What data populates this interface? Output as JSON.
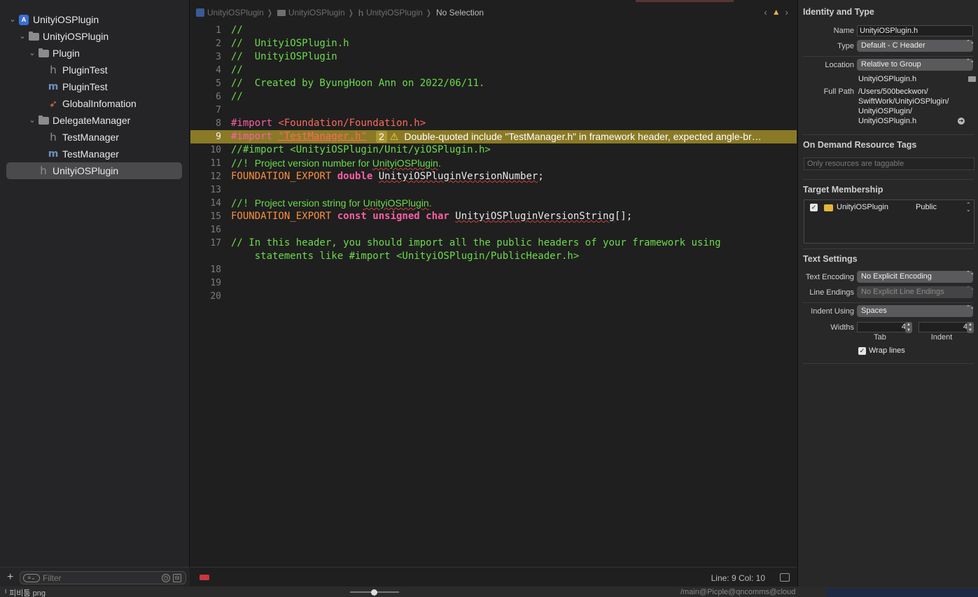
{
  "navigator": {
    "tree": [
      {
        "label": "UnityiOSPlugin",
        "icon": "project-icon",
        "level": 0,
        "expanded": true
      },
      {
        "label": "UnityiOSPlugin",
        "icon": "folder-icon",
        "level": 1,
        "expanded": true
      },
      {
        "label": "Plugin",
        "icon": "folder-icon",
        "level": 2,
        "expanded": true
      },
      {
        "label": "PluginTest",
        "icon": "header-file-icon",
        "level": 3
      },
      {
        "label": "PluginTest",
        "icon": "objc-file-icon",
        "level": 3
      },
      {
        "label": "GlobalInfomation",
        "icon": "swift-file-icon",
        "level": 3
      },
      {
        "label": "DelegateManager",
        "icon": "folder-icon",
        "level": 2,
        "expanded": true
      },
      {
        "label": "TestManager",
        "icon": "header-file-icon",
        "level": 3
      },
      {
        "label": "TestManager",
        "icon": "objc-file-icon",
        "level": 3
      },
      {
        "label": "UnityiOSPlugin",
        "icon": "header-file-icon",
        "level": 2,
        "selected": true
      }
    ],
    "filter_placeholder": "Filter"
  },
  "jumpbar": {
    "items": [
      "UnityiOSPlugin",
      "UnityiOSPlugin",
      "UnityiOSPlugin"
    ],
    "selection": "No Selection"
  },
  "editor": {
    "lines": {
      "l1": {
        "num": "1",
        "text": "//"
      },
      "l2": {
        "num": "2",
        "text": "//  UnityiOSPlugin.h"
      },
      "l3": {
        "num": "3",
        "text": "//  UnityiOSPlugin"
      },
      "l4": {
        "num": "4",
        "text": "//"
      },
      "l5": {
        "num": "5",
        "text": "//  Created by ByungHoon Ann on 2022/06/11."
      },
      "l6": {
        "num": "6",
        "text": "//"
      },
      "l7": {
        "num": "7"
      },
      "l8": {
        "num": "8",
        "kw": "#import ",
        "path": "<Foundation/Foundation.h>"
      },
      "l9": {
        "num": "9",
        "kw": "#import ",
        "path": "\"TestManager.h\""
      },
      "l10": {
        "num": "10",
        "text": "//#import <UnityiOSPlugin/Unit/yiOSPlugin.h>"
      },
      "l11": {
        "num": "11",
        "prefix": "//! ",
        "doc_pre": "Project version number for ",
        "doc_name": "UnityiOSPlugin",
        "doc_post": "."
      },
      "l12": {
        "num": "12",
        "macro": "FOUNDATION_EXPORT ",
        "type": "double ",
        "ident": "UnityiOSPluginVersionNumber",
        "post": ";"
      },
      "l13": {
        "num": "13"
      },
      "l14": {
        "num": "14",
        "prefix": "//! ",
        "doc_pre": "Project version string for ",
        "doc_name": "UnityiOSPlugin",
        "doc_post": "."
      },
      "l15": {
        "num": "15",
        "macro": "FOUNDATION_EXPORT ",
        "type": "const unsigned char ",
        "ident": "UnityiOSPluginVersionString",
        "post": "[];"
      },
      "l16": {
        "num": "16"
      },
      "l17": {
        "num": "17",
        "text": "// In this header, you should import all the public headers of your framework using",
        "text2": "    statements like #import <UnityiOSPlugin/PublicHeader.h>"
      },
      "l18": {
        "num": "18"
      },
      "l19": {
        "num": "19"
      },
      "l20": {
        "num": "20"
      }
    },
    "issue": {
      "count": "2",
      "message": "Double-quoted include \"TestManager.h\" in framework header, expected angle-br…"
    }
  },
  "statusbar": {
    "position": "Line: 9  Col: 10"
  },
  "inspector": {
    "identity_title": "Identity and Type",
    "name_label": "Name",
    "name_value": "UnityiOSPlugin.h",
    "type_label": "Type",
    "type_value": "Default - C Header",
    "location_label": "Location",
    "location_value": "Relative to Group",
    "location_file": "UnityiOSPlugin.h",
    "fullpath_label": "Full Path",
    "fullpath_lines": [
      "/Users/500beckwon/",
      "SwiftWork/UnityiOSPlugin/",
      "UnityiOSPlugin/",
      "UnityiOSPlugin.h"
    ],
    "odr_title": "On Demand Resource Tags",
    "odr_placeholder": "Only resources are taggable",
    "membership_title": "Target Membership",
    "membership_target": "UnityiOSPlugin",
    "membership_visibility": "Public",
    "text_settings_title": "Text Settings",
    "encoding_label": "Text Encoding",
    "encoding_value": "No Explicit Encoding",
    "endings_label": "Line Endings",
    "endings_value": "No Explicit Line Endings",
    "indent_using_label": "Indent Using",
    "indent_using_value": "Spaces",
    "widths_label": "Widths",
    "tab_value": "4",
    "indent_value": "4",
    "tab_caption": "Tab",
    "indent_caption": "Indent",
    "wrap_label": "Wrap lines"
  },
  "desktop": {
    "left_text": "ᅵ 피비툼 png",
    "right_text": "/main@Picple@qncomms@cloud"
  }
}
